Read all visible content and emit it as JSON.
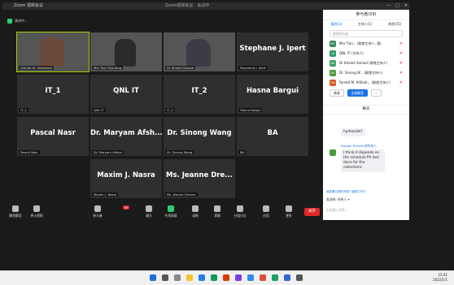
{
  "window": {
    "title": "Zoom 视频会议",
    "center_title": "Zoom视频会议 - 会议中",
    "controls": [
      "—",
      "□",
      "✕"
    ]
  },
  "meeting_topbar": {
    "label": "演讲中..."
  },
  "tiles": [
    {
      "name": "",
      "label": "Ahmad M. Alshaman",
      "video": true
    },
    {
      "name": "",
      "label": "Mrs Tian Shouting",
      "video": true
    },
    {
      "name": "",
      "label": "Dr Khaled Samad",
      "video": true
    },
    {
      "name": "Stephane J. Ipert",
      "label": "Stephane J. Ipert",
      "video": false
    },
    {
      "name": "IT_1",
      "label": "IT_1",
      "video": false
    },
    {
      "name": "QNL IT",
      "label": "QNL IT",
      "video": false
    },
    {
      "name": "IT_2",
      "label": "IT_2",
      "video": false
    },
    {
      "name": "Hasna Bargui",
      "label": "Hasna Bargui",
      "video": false
    },
    {
      "name": "Pascal Nasr",
      "label": "Pascal Nasr",
      "video": false
    },
    {
      "name": "Dr. Maryam Afsh...",
      "label": "Dr. Maryam Afshar",
      "video": false
    },
    {
      "name": "Dr. Sinong Wang",
      "label": "Dr. Sinong Wang",
      "video": false
    },
    {
      "name": "BA",
      "label": "BA",
      "video": false
    },
    {
      "name": "Maxim J. Nasra",
      "label": "Maxim J. Nasra",
      "video": false
    },
    {
      "name": "Ms. Jeanne Dre...",
      "label": "Ms. Jeanne Dreano",
      "video": false
    }
  ],
  "toolbar": {
    "items": [
      "解除静音",
      "停止视频",
      "参与者",
      "共享屏幕",
      "聊天",
      "录制",
      "表情",
      "更多",
      "分组讨论",
      "应用"
    ],
    "participant_count": "59",
    "end_label": "离开"
  },
  "sidebar": {
    "header": "参与者(59)",
    "tabs": [
      "嘉宾(3)",
      "主持人(1)",
      "其他(55)"
    ],
    "search_placeholder": "查找参与者",
    "participants": [
      {
        "initials": "MT",
        "name": "Mrs Tian... (联席主持人, 我)",
        "color": "#3c8a5a"
      },
      {
        "initials": "QI",
        "name": "QNL IT (主持人)",
        "color": "#2d9c6b"
      },
      {
        "initials": "DK",
        "name": "Dr Khaled Samad (联席主持人)",
        "color": "#3aa060"
      },
      {
        "initials": "DS",
        "name": "Dr. Sinong W... (联席主持人)",
        "color": "#4a9c3a"
      },
      {
        "initials": "FM",
        "name": "Fareed M. AlShoh... (联席主持人)",
        "color": "#d85a1e"
      }
    ],
    "buttons": [
      "邀请",
      "全体静音",
      "..."
    ],
    "chat_header": "聊天",
    "chat_messages": [
      {
        "sender": "",
        "text": "hydroxide?"
      },
      {
        "sender": "Hadeel Sheekh对所有人",
        "text": "I think it depends on the schedule Ph test done for the collections"
      }
    ],
    "notice": "谁能看见我的消息? 读取打开分",
    "to_label": "发送给: 所有人 ▾",
    "input_placeholder": "在此输入消息..."
  },
  "taskbar": {
    "time": "15:41",
    "date": "2022/1/1"
  }
}
